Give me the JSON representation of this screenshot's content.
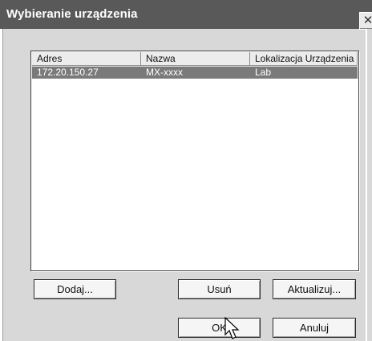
{
  "window": {
    "title": "Wybieranie urządzenia",
    "close_glyph": "✕"
  },
  "list": {
    "columns": [
      "Adres",
      "Nazwa",
      "Lokalizacja Urządzenia"
    ],
    "rows": [
      {
        "address": "172.20.150.27",
        "name": "MX-xxxx",
        "location": "Lab",
        "selected": true
      }
    ]
  },
  "buttons": {
    "add": "Dodaj...",
    "remove": "Usuń",
    "refresh": "Aktualizuj...",
    "ok": "OK",
    "cancel": "Anuluj"
  },
  "cursor": {
    "icon": "arrow-cursor-icon"
  },
  "colors": {
    "titlebar": "#595959",
    "selection": "#7a7a7a",
    "dialog": "#d8d8d8"
  }
}
